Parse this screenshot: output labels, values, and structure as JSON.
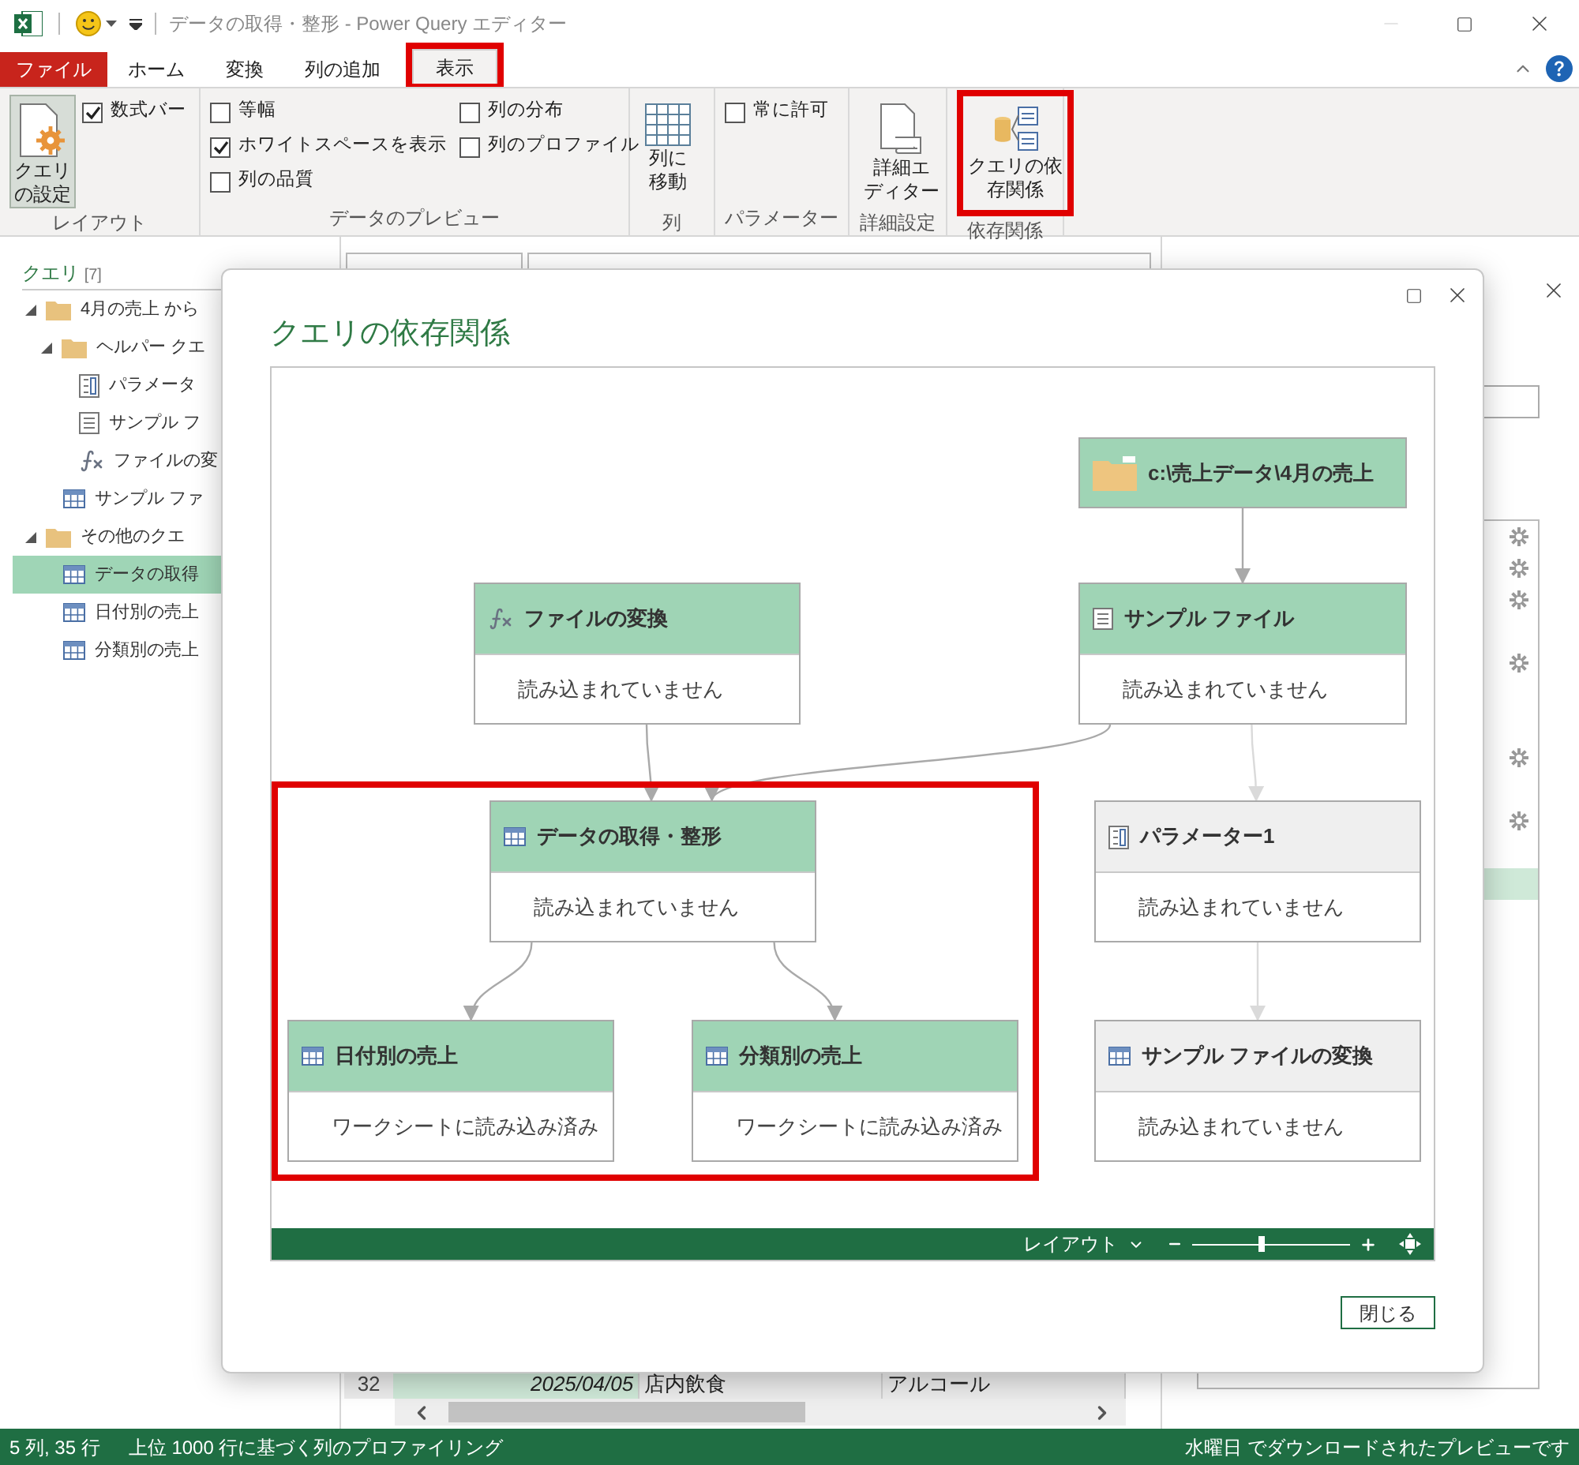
{
  "window": {
    "title": "データの取得・整形 - Power Query エディター"
  },
  "tabs": [
    {
      "label": "ファイル",
      "kind": "file",
      "selected": false,
      "highlighted": false
    },
    {
      "label": "ホーム",
      "kind": "tab",
      "selected": false,
      "highlighted": false
    },
    {
      "label": "変換",
      "kind": "tab",
      "selected": false,
      "highlighted": false
    },
    {
      "label": "列の追加",
      "kind": "tab",
      "selected": false,
      "highlighted": false
    },
    {
      "label": "表示",
      "kind": "tab",
      "selected": true,
      "highlighted": true
    }
  ],
  "ribbon_groups": [
    {
      "label": "レイアウト",
      "items": [
        {
          "kind": "large",
          "label_lines": [
            "クエリ",
            "の設定"
          ],
          "selected": true,
          "highlighted": false
        },
        {
          "kind": "checkbox",
          "label": "数式バー",
          "checked": true
        }
      ]
    },
    {
      "label": "データのプレビュー",
      "items": [
        {
          "kind": "checkbox",
          "label": "等幅",
          "checked": false
        },
        {
          "kind": "checkbox",
          "label": "ホワイトスペースを表示",
          "checked": true
        },
        {
          "kind": "checkbox",
          "label": "列の品質",
          "checked": false
        },
        {
          "kind": "checkbox",
          "label": "列の分布",
          "checked": false
        },
        {
          "kind": "checkbox",
          "label": "列のプロファイル",
          "checked": false
        }
      ]
    },
    {
      "label": "列",
      "items": [
        {
          "kind": "large",
          "label_lines": [
            "列に",
            "移動"
          ],
          "selected": false,
          "highlighted": false
        }
      ]
    },
    {
      "label": "パラメーター",
      "items": [
        {
          "kind": "checkbox",
          "label": "常に許可",
          "checked": false
        }
      ]
    },
    {
      "label": "詳細設定",
      "items": [
        {
          "kind": "large",
          "label_lines": [
            "詳細エ",
            "ディター"
          ],
          "selected": false,
          "highlighted": false
        }
      ]
    },
    {
      "label": "依存関係",
      "items": [
        {
          "kind": "large",
          "label_lines": [
            "クエリの依",
            "存関係"
          ],
          "selected": false,
          "highlighted": true
        }
      ]
    }
  ],
  "query_pane": {
    "header": "クエリ",
    "count": "[7]",
    "tree": [
      {
        "label": "4月の売上 から",
        "kind": "folder",
        "expanded": true,
        "selected": false,
        "children": [
          {
            "label": "ヘルパー クエ",
            "kind": "folder",
            "expanded": true,
            "selected": false,
            "children": [
              {
                "label": "パラメータ",
                "kind": "parameter",
                "selected": false
              },
              {
                "label": "サンプル フ",
                "kind": "file",
                "selected": false
              },
              {
                "label": "ファイルの変",
                "kind": "function",
                "selected": false
              }
            ]
          },
          {
            "label": "サンプル ファ",
            "kind": "table",
            "selected": false
          }
        ]
      },
      {
        "label": "その他のクエ",
        "kind": "folder",
        "expanded": true,
        "selected": false,
        "children": [
          {
            "label": "データの取得",
            "kind": "table",
            "selected": true
          },
          {
            "label": "日付別の売上",
            "kind": "table",
            "selected": false
          },
          {
            "label": "分類別の売上",
            "kind": "table",
            "selected": false
          }
        ]
      }
    ]
  },
  "preview_row": {
    "number": "32",
    "cells": [
      "2025/04/05",
      "店内飲食",
      "アルコール"
    ]
  },
  "settings_pane": {
    "steps": [
      {
        "has_settings": true,
        "selected": false
      },
      {
        "has_settings": true,
        "selected": false
      },
      {
        "has_settings": true,
        "selected": false
      },
      {
        "has_settings": false,
        "selected": false
      },
      {
        "has_settings": true,
        "selected": false
      },
      {
        "has_settings": false,
        "selected": false
      },
      {
        "has_settings": false,
        "selected": false
      },
      {
        "has_settings": true,
        "selected": false
      },
      {
        "has_settings": false,
        "selected": false
      },
      {
        "has_settings": true,
        "selected": false
      },
      {
        "has_settings": false,
        "selected": false
      },
      {
        "has_settings": false,
        "selected": true
      }
    ]
  },
  "dialog": {
    "title": "クエリの依存関係",
    "highlight_frame": true,
    "nodes": [
      {
        "name": "c:\\売上データ\\4月の売上",
        "kind": "folder",
        "dimmed": false
      },
      {
        "name": "ファイルの変換",
        "status": "読み込まれていません",
        "kind": "function",
        "dimmed": false
      },
      {
        "name": "サンプル ファイル",
        "status": "読み込まれていません",
        "kind": "file",
        "dimmed": false
      },
      {
        "name": "データの取得・整形",
        "status": "読み込まれていません",
        "kind": "table",
        "dimmed": false
      },
      {
        "name": "パラメーター1",
        "status": "読み込まれていません",
        "kind": "parameter",
        "dimmed": true
      },
      {
        "name": "日付別の売上",
        "status": "ワークシートに読み込み済み",
        "kind": "table",
        "dimmed": false
      },
      {
        "name": "分類別の売上",
        "status": "ワークシートに読み込み済み",
        "kind": "table",
        "dimmed": false
      },
      {
        "name": "サンプル ファイルの変換",
        "status": "読み込まれていません",
        "kind": "table",
        "dimmed": true
      }
    ],
    "layout_label": "レイアウト",
    "zoom": {
      "level": 0.44
    },
    "close_button": "閉じる"
  },
  "status_bar": {
    "left": [
      "5 列, 35 行",
      "上位 1000 行に基づく列のプロファイリング"
    ],
    "right": "水曜日 でダウンロードされたプレビューです"
  }
}
